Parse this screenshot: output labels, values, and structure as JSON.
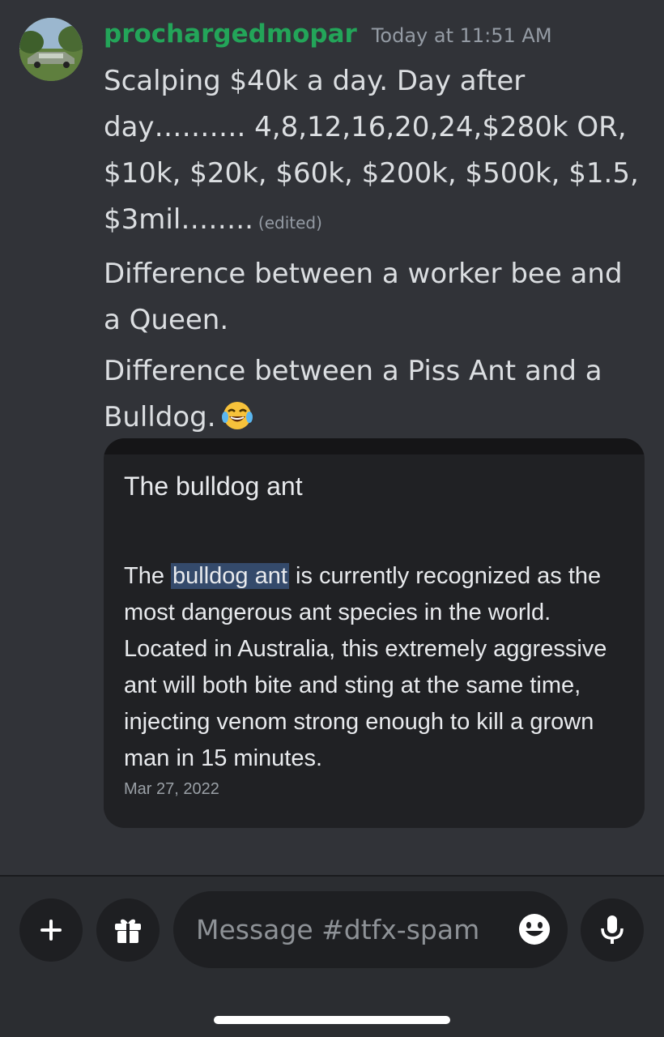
{
  "message": {
    "username": "prochargedmopar",
    "timestamp": "Today at 11:51 AM",
    "paragraph1": "Scalping $40k a day. Day after day………. 4,8,12,16,20,24,$280k OR, $10k, $20k, $60k, $200k, $500k, $1.5, $3mil……..",
    "edited_label": "(edited)",
    "paragraph2": "Difference between a worker bee and a Queen.",
    "paragraph3": "Difference between a Piss Ant and a Bulldog.",
    "emoji": "joy-emoji"
  },
  "embed": {
    "title": "The bulldog ant",
    "highlight": "bulldog ant",
    "text_before": "The ",
    "text_after": " is currently recognized as the most dangerous ant species in the world. Located in Australia, this extremely aggressive ant will both bite and sting at the same time, injecting venom strong enough to kill a grown man in 15 minutes.",
    "date": "Mar 27, 2022"
  },
  "composer": {
    "placeholder": "Message #dtfx-spam",
    "plus_icon": "plus-icon",
    "gift_icon": "gift-icon",
    "emoji_icon": "emoji-icon",
    "mic_icon": "microphone-icon"
  },
  "colors": {
    "background": "#313338",
    "username": "#23a559",
    "embed_background": "#202124",
    "highlight": "#344a6b"
  }
}
